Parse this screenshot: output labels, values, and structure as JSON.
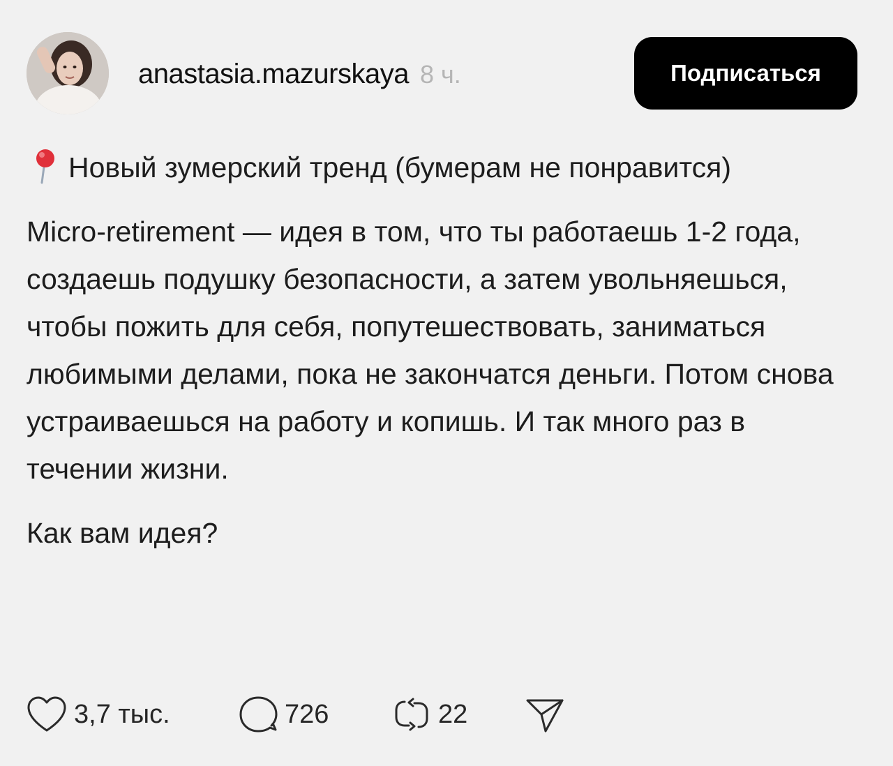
{
  "post": {
    "author": {
      "username": "anastasia.mazurskaya",
      "timestamp": "8 ч."
    },
    "follow_button": {
      "label": "Подписаться"
    },
    "paragraphs": {
      "p1": "Новый зумерский тренд (бумерам не понравится)",
      "p2": "Micro-retirement — идея в том, что ты работаешь 1-2 года, создаешь подушку безопасности, а затем увольняешься, чтобы пожить для себя, попутешествовать, заниматься любимыми делами, пока не закончатся деньги. Потом снова устраиваешься на работу и копишь. И так много раз в течении жизни.",
      "p3": "Как вам идея?"
    },
    "icons": {
      "pin": "round-pushpin-icon",
      "like": "heart-icon",
      "comment": "comment-bubble-icon",
      "repost": "repost-icon",
      "share": "send-icon"
    },
    "actions": {
      "likes": "3,7 тыс.",
      "comments": "726",
      "reposts": "22"
    },
    "colors": {
      "background": "#f1f1f1",
      "button": "#000000",
      "button_text": "#ffffff",
      "timestamp": "#b5b5b5",
      "pin_head": "#e0303a"
    }
  }
}
